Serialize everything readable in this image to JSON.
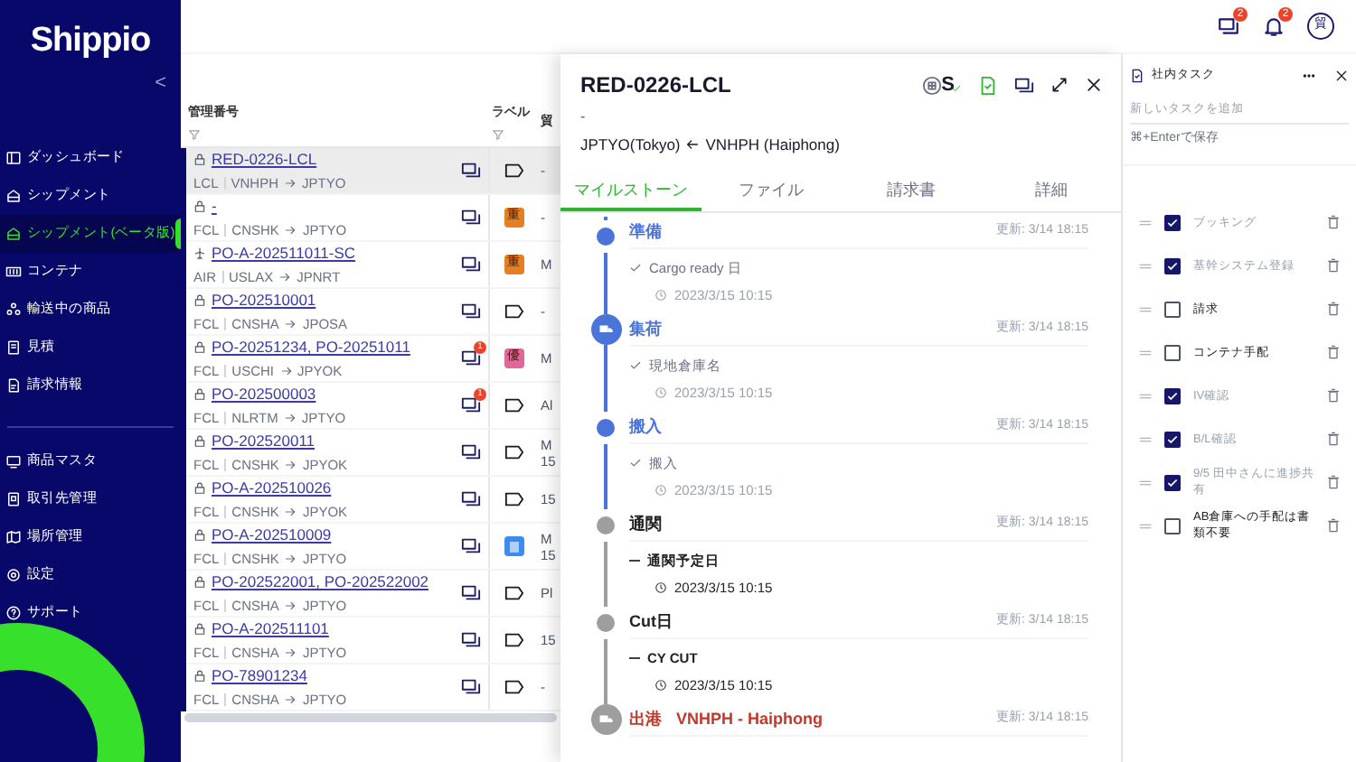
{
  "sidebar": {
    "logo": "Shippio",
    "collapse": "<",
    "groups": [
      [
        {
          "label": "ダッシュボード",
          "selected": false
        },
        {
          "label": "シップメント",
          "selected": false
        },
        {
          "label": "シップメント(ベータ版)",
          "selected": true
        },
        {
          "label": "コンテナ",
          "selected": false
        },
        {
          "label": "輸送中の商品",
          "selected": false
        },
        {
          "label": "見積",
          "selected": false
        },
        {
          "label": "請求情報",
          "selected": false
        }
      ],
      [
        {
          "label": "商品マスタ",
          "selected": false
        },
        {
          "label": "取引先管理",
          "selected": false
        },
        {
          "label": "場所管理",
          "selected": false
        },
        {
          "label": "設定",
          "selected": false
        },
        {
          "label": "サポート",
          "selected": false
        }
      ]
    ]
  },
  "top_bar": {
    "message_badge": "2",
    "notification_badge": "2",
    "avatar": "貿"
  },
  "table": {
    "columns": [
      "管理番号",
      "ラベル",
      "貿"
    ],
    "rows": [
      {
        "kind": "sea",
        "id": "RED-0226-LCL",
        "mode": "LCL",
        "origin": "VNHPH",
        "destination": "JPTYO",
        "selected": true,
        "label": {
          "kind": "tag"
        },
        "column_3": [
          "-"
        ]
      },
      {
        "kind": "sea",
        "id": "-",
        "mode": "FCL",
        "origin": "CNSHK",
        "destination": "JPTYO",
        "selected": false,
        "label": {
          "kind": "badge",
          "text": "重",
          "color": "#e67e22"
        },
        "column_3": [
          "-"
        ]
      },
      {
        "kind": "air",
        "id": "PO-A-202511011-SC",
        "mode": "AIR",
        "origin": "USLAX",
        "destination": "JPNRT",
        "selected": false,
        "label": {
          "kind": "badge",
          "text": "重",
          "color": "#e67e22"
        },
        "column_3": [
          "M"
        ]
      },
      {
        "kind": "sea",
        "id": "PO-202510001",
        "mode": "FCL",
        "origin": "CNSHA",
        "destination": "JPOSA",
        "selected": false,
        "label": {
          "kind": "tag"
        },
        "column_3": [
          "-"
        ]
      },
      {
        "kind": "sea",
        "id": "PO-20251234, PO-20251011",
        "mode": "FCL",
        "origin": "USCHI",
        "destination": "JPYOK",
        "selected": false,
        "unread": "1",
        "label": {
          "kind": "badge",
          "text": "優",
          "color": "#e0679a"
        },
        "column_3": [
          "M"
        ]
      },
      {
        "kind": "sea",
        "id": "PO-202500003",
        "mode": "FCL",
        "origin": "NLRTM",
        "destination": "JPTYO",
        "selected": false,
        "unread": "1",
        "label": {
          "kind": "tag"
        },
        "column_3": [
          "Al"
        ]
      },
      {
        "kind": "sea",
        "id": "PO-202520011",
        "mode": "FCL",
        "origin": "CNSHK",
        "destination": "JPYOK",
        "selected": false,
        "label": {
          "kind": "tag"
        },
        "column_3": [
          "M",
          "15"
        ]
      },
      {
        "kind": "sea",
        "id": "PO-A-202510026",
        "mode": "FCL",
        "origin": "CNSHK",
        "destination": "JPYOK",
        "selected": false,
        "label": {
          "kind": "tag"
        },
        "column_3": [
          "15"
        ]
      },
      {
        "kind": "sea",
        "id": "PO-A-202510009",
        "mode": "FCL",
        "origin": "CNSHK",
        "destination": "JPTYO",
        "selected": false,
        "label": {
          "kind": "badge",
          "color": "#3d8bf0"
        },
        "column_3": [
          "M",
          "15"
        ]
      },
      {
        "kind": "sea",
        "id": "PO-202522001, PO-202522002",
        "mode": "FCL",
        "origin": "CNSHA",
        "destination": "JPTYO",
        "selected": false,
        "label": {
          "kind": "tag"
        },
        "column_3": [
          "Pl"
        ]
      },
      {
        "kind": "sea",
        "id": "PO-A-202511101",
        "mode": "FCL",
        "origin": "CNSHA",
        "destination": "JPTYO",
        "selected": false,
        "label": {
          "kind": "tag"
        },
        "column_3": [
          "15"
        ]
      },
      {
        "kind": "sea",
        "id": "PO-78901234",
        "mode": "FCL",
        "origin": "CNSHA",
        "destination": "JPTYO",
        "selected": false,
        "label": {
          "kind": "tag"
        },
        "column_3": [
          "-"
        ]
      }
    ]
  },
  "detail": {
    "title": "RED-0226-LCL",
    "subtitle": "-",
    "destination": "JPTYO(Tokyo)",
    "origin": "VNHPH (Haiphong)",
    "header_badge": "S",
    "tabs": [
      {
        "label": "マイルストーン",
        "selected": true
      },
      {
        "label": "ファイル",
        "selected": false
      },
      {
        "label": "請求書",
        "selected": false
      },
      {
        "label": "詳細",
        "selected": false
      }
    ],
    "milestones": [
      {
        "kind": "dot",
        "title": "準備",
        "done": true,
        "alert": false,
        "updated": "更新: 3/14 18:15",
        "items": [
          {
            "label": "Cargo ready 日",
            "date": "2023/3/15 10:15",
            "done": true
          }
        ]
      },
      {
        "kind": "large",
        "title": "集荷",
        "done": true,
        "alert": false,
        "updated": "更新: 3/14 18:15",
        "items": [
          {
            "label": "現地倉庫名",
            "date": "2023/3/15 10:15",
            "done": true
          }
        ]
      },
      {
        "kind": "dot",
        "title": "搬入",
        "done": true,
        "alert": false,
        "updated": "更新: 3/14 18:15",
        "items": [
          {
            "label": "搬入",
            "date": "2023/3/15 10:15",
            "done": true
          }
        ]
      },
      {
        "kind": "dot",
        "title": "通関",
        "done": false,
        "alert": false,
        "updated": "更新: 3/14 18:15",
        "items": [
          {
            "label": "通関予定日",
            "date": "2023/3/15 10:15",
            "done": false
          }
        ]
      },
      {
        "kind": "dot",
        "title": "Cut日",
        "done": false,
        "alert": false,
        "updated": "更新: 3/14 18:15",
        "items": [
          {
            "label": "CY CUT",
            "date": "2023/3/15 10:15",
            "done": false
          }
        ]
      },
      {
        "kind": "large",
        "title": "出港",
        "place": "VNHPH - Haiphong",
        "done": false,
        "alert": true,
        "updated": "更新: 3/14 18:15"
      }
    ]
  },
  "tasks": {
    "title": "社内タスク",
    "placeholder": "新しいタスクを追加",
    "hint": "⌘+Enterで保存",
    "items": [
      {
        "label": "ブッキング",
        "checked": true
      },
      {
        "label": "基幹システム登録",
        "checked": true
      },
      {
        "label": "請求",
        "checked": false
      },
      {
        "label": "コンテナ手配",
        "checked": false
      },
      {
        "label": "IV確認",
        "checked": true
      },
      {
        "label": "B/L確認",
        "checked": true
      },
      {
        "label": "9/5 田中さんに進捗共有",
        "checked": true
      },
      {
        "label": "AB倉庫への手配は書類不要",
        "checked": false
      }
    ]
  }
}
